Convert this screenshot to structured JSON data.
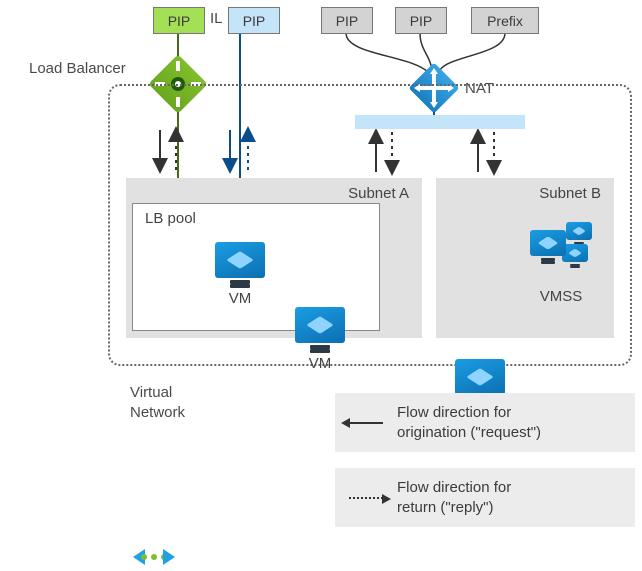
{
  "top": {
    "pip_green": "PIP",
    "il": "IL",
    "pip_blue": "PIP",
    "pip_gray_1": "PIP",
    "pip_gray_2": "PIP",
    "prefix": "Prefix"
  },
  "labels": {
    "load_balancer": "Load Balancer",
    "nat": "NAT",
    "subnet_a": "Subnet A",
    "subnet_b": "Subnet B",
    "lb_pool": "LB pool",
    "vm": "VM",
    "vmss": "VMSS",
    "virtual_network_line1": "Virtual",
    "virtual_network_line2": "Network"
  },
  "legend": {
    "request_line1": "Flow direction for",
    "request_line2": "origination (\"request\")",
    "reply_line1": "Flow direction for",
    "reply_line2": "return (\"reply\")"
  },
  "colors": {
    "green": "#a3e056",
    "blue_light": "#c4e4f9",
    "gray": "#d3d3d3",
    "lb_green": "#6ba822",
    "nat_blue": "#1b9de4",
    "dark": "#333333",
    "navy": "#0b4d8a"
  }
}
